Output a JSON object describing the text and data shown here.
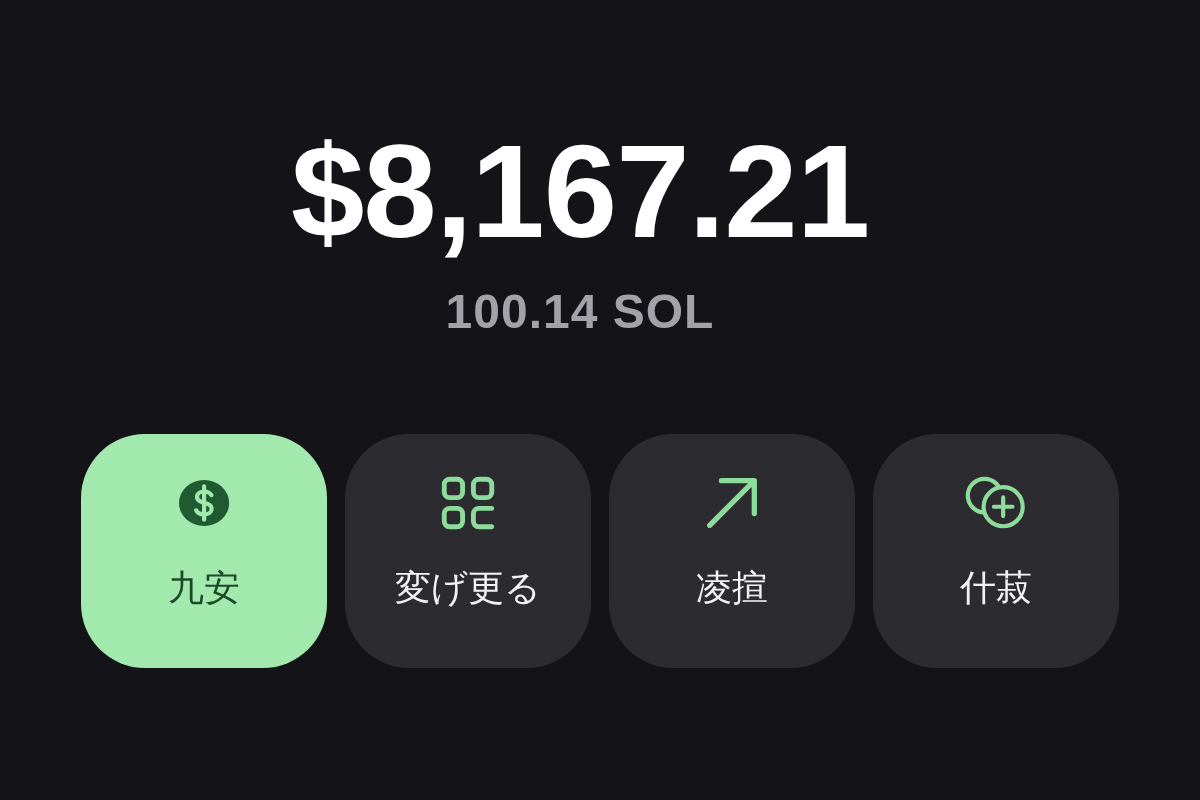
{
  "balance": {
    "amount": "$8,167.21",
    "token_amount": "100.14 SOL"
  },
  "actions": [
    {
      "kind": "dollar",
      "label": "九安",
      "selected": true
    },
    {
      "kind": "grid",
      "label": "変げ更る",
      "selected": false
    },
    {
      "kind": "arrow",
      "label": "凌揎",
      "selected": false
    },
    {
      "kind": "coins",
      "label": "什菽",
      "selected": false
    }
  ]
}
